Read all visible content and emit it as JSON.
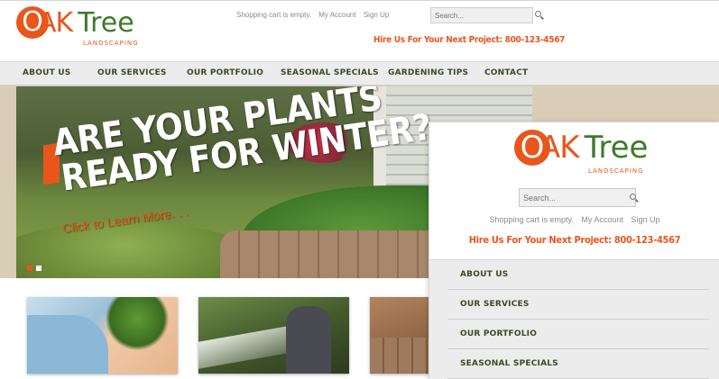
{
  "brand": {
    "oak": "OAK",
    "tree": "Tree",
    "sub": "LANDSCAPING",
    "orange": "#e8561c",
    "green": "#3d7a2a"
  },
  "header": {
    "cart": "Shopping cart is empty.",
    "account": "My Account",
    "signup": "Sign Up",
    "search_placeholder": "Search...",
    "hire": "Hire Us For Your Next Project: 800-123-4567"
  },
  "nav": [
    "ABOUT US",
    "OUR SERVICES",
    "OUR PORTFOLIO",
    "SEASONAL SPECIALS",
    "GARDENING TIPS",
    "CONTACT"
  ],
  "hero": {
    "line1": "ARE YOUR PLANTS",
    "line2": "READY FOR WINTER?",
    "cta": "Click to Learn More. . .",
    "dots": [
      "active",
      "inactive"
    ]
  },
  "mobile": {
    "search_placeholder": "Search...",
    "cart": "Shopping cart is empty.",
    "account": "My Account",
    "signup": "Sign Up",
    "hire": "Hire Us For Your Next Project: 800-123-4567",
    "nav": [
      "ABOUT US",
      "OUR SERVICES",
      "OUR PORTFOLIO",
      "SEASONAL SPECIALS"
    ]
  }
}
